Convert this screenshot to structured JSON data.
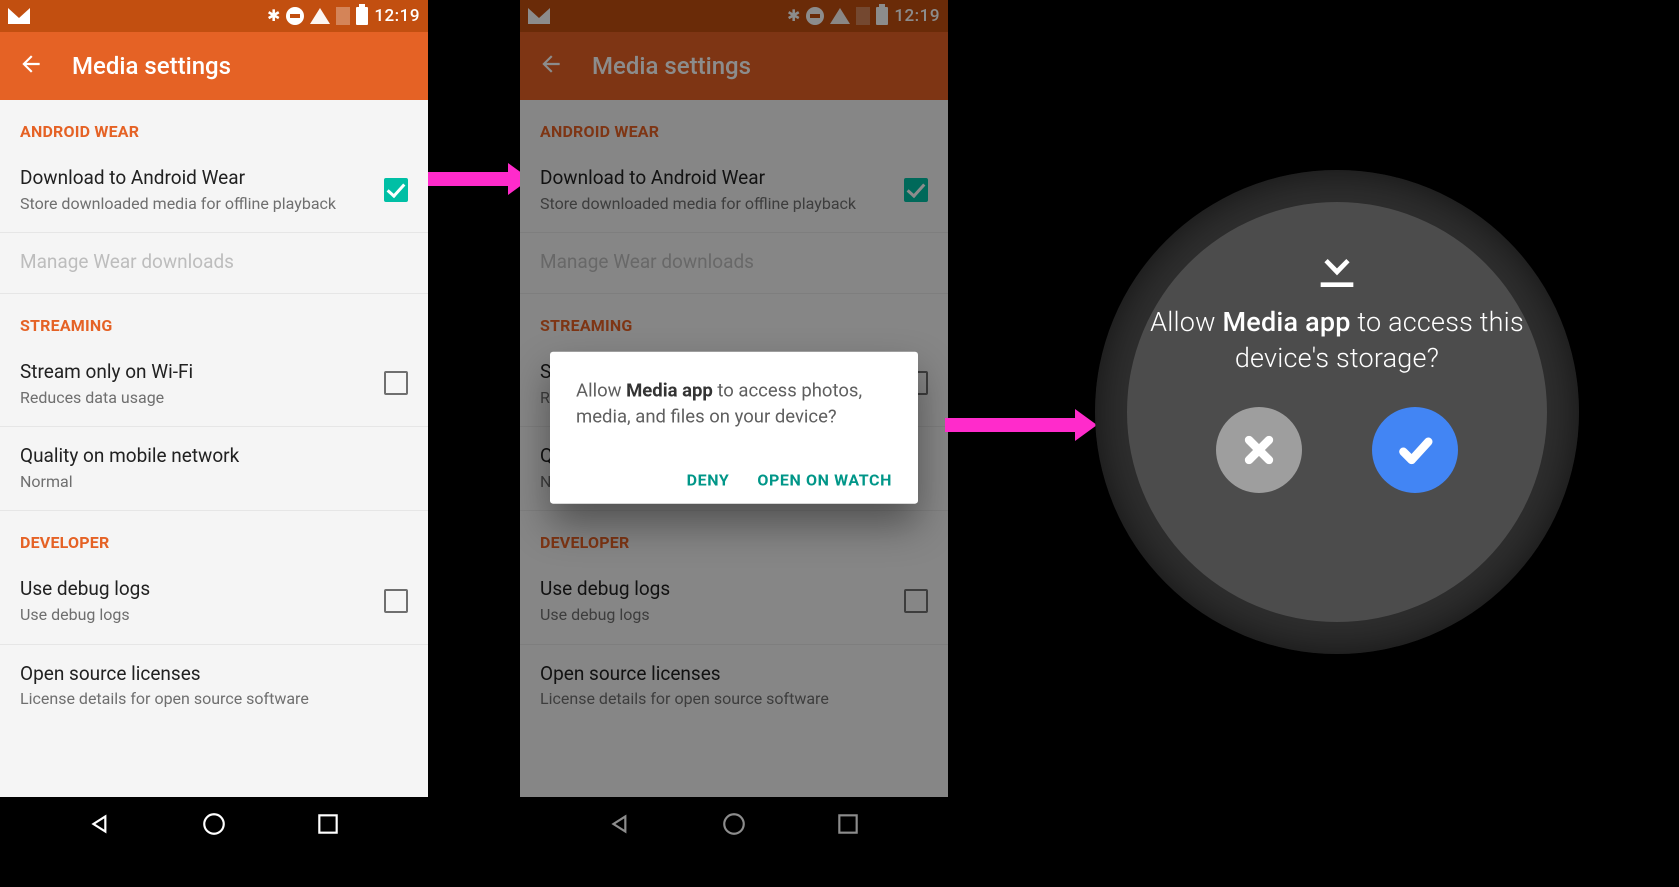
{
  "status": {
    "time": "12:19"
  },
  "appbar": {
    "title": "Media settings"
  },
  "sections": {
    "wear": {
      "header": "ANDROID WEAR",
      "download": {
        "title": "Download to Android Wear",
        "sub": "Store downloaded media for offline playback",
        "checked": true
      },
      "manage": {
        "title": "Manage Wear downloads"
      }
    },
    "streaming": {
      "header": "STREAMING",
      "wifi": {
        "title": "Stream only on Wi-Fi",
        "sub": "Reduces data usage",
        "checked": false
      },
      "quality": {
        "title": "Quality on mobile network",
        "sub": "Normal"
      }
    },
    "developer": {
      "header": "DEVELOPER",
      "debug": {
        "title": "Use debug logs",
        "sub": "Use debug logs",
        "checked": false
      },
      "oss": {
        "title": "Open source licenses",
        "sub": "License details for open source software"
      }
    }
  },
  "dialog": {
    "pre": "Allow ",
    "app": "Media app",
    "post": " to access photos, media, and files on your device?",
    "deny": "DENY",
    "open": "OPEN ON WATCH"
  },
  "watch": {
    "pre": "Allow ",
    "app": "Media app",
    "post": " to access this device's storage?"
  }
}
